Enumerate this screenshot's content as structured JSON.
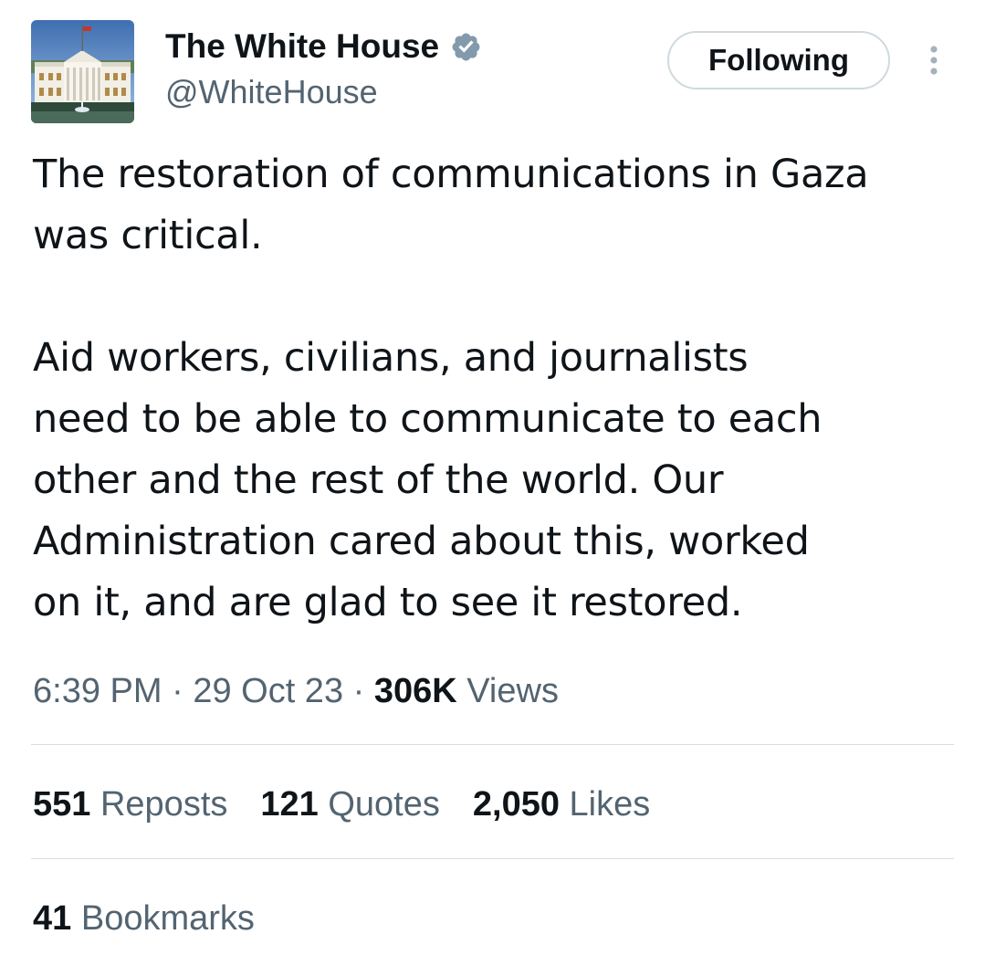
{
  "author": {
    "display_name": "The White House",
    "handle": "@WhiteHouse",
    "verified_icon": "verified-badge-icon",
    "verified_color": "#829aab",
    "avatar_icon": "white-house-avatar"
  },
  "follow_button": {
    "label": "Following"
  },
  "more_icon": "more-vertical-icon",
  "tweet": {
    "paragraphs": [
      "The restoration of communications in Gaza\nwas critical.",
      "Aid workers, civilians, and journalists\nneed to be able to communicate to each\nother and the rest of the world. Our\nAdministration cared about this, worked\non it, and are glad to see it restored."
    ]
  },
  "meta": {
    "time": "6:39 PM",
    "separator": "·",
    "date": "29 Oct 23",
    "views_count": "306K",
    "views_label": "Views"
  },
  "stats": {
    "reposts_count": "551",
    "reposts_label": "Reposts",
    "quotes_count": "121",
    "quotes_label": "Quotes",
    "likes_count": "2,050",
    "likes_label": "Likes",
    "bookmarks_count": "41",
    "bookmarks_label": "Bookmarks"
  },
  "colors": {
    "text_primary": "#0f1419",
    "text_secondary": "#536471",
    "button_border": "#cfd9de",
    "divider": "#d6dde1"
  }
}
